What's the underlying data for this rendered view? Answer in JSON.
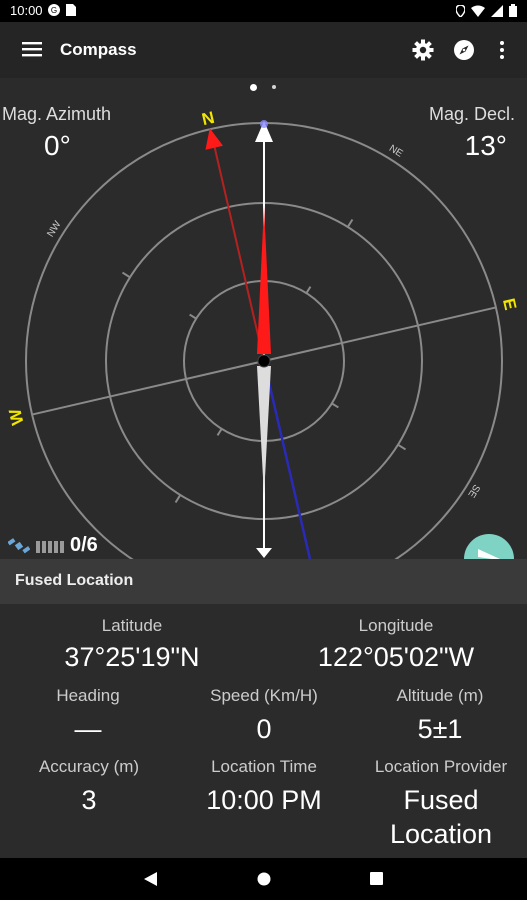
{
  "status_bar": {
    "time": "10:00",
    "icons_left": [
      "google-icon",
      "sim-icon"
    ],
    "icons_right": [
      "location-icon",
      "wifi-icon",
      "signal-icon",
      "battery-icon"
    ]
  },
  "app_bar": {
    "title": "Compass",
    "actions": [
      "settings-icon",
      "compass-icon",
      "more-vert-icon"
    ]
  },
  "pager": {
    "pages": 2,
    "active": 0
  },
  "compass": {
    "mag_azimuth_label": "Mag. Azimuth",
    "mag_azimuth_value": "0°",
    "mag_decl_label": "Mag. Decl.",
    "mag_decl_value": "13°",
    "cardinals": {
      "n": "N",
      "e": "E",
      "w": "W"
    },
    "intercardinals": {
      "ne": "NE",
      "nw": "NW",
      "se": "SE"
    },
    "satellites": "0/6",
    "colors": {
      "north": "#ff1a1a",
      "cardinal": "#f2e600",
      "needle_blue": "#2a2ab8"
    }
  },
  "location": {
    "header": "Fused Location",
    "latitude_label": "Latitude",
    "latitude_value": "37°25'19\"N",
    "longitude_label": "Longitude",
    "longitude_value": "122°05'02\"W",
    "heading_label": "Heading",
    "heading_value": "—",
    "speed_label": "Speed (Km/H)",
    "speed_value": "0",
    "altitude_label": "Altitude (m)",
    "altitude_value": "5±1",
    "accuracy_label": "Accuracy (m)",
    "accuracy_value": "3",
    "time_label": "Location Time",
    "time_value": "10:00 PM",
    "provider_label": "Location Provider",
    "provider_value_line1": "Fused",
    "provider_value_line2": "Location"
  },
  "accent": "#7fd3c4"
}
